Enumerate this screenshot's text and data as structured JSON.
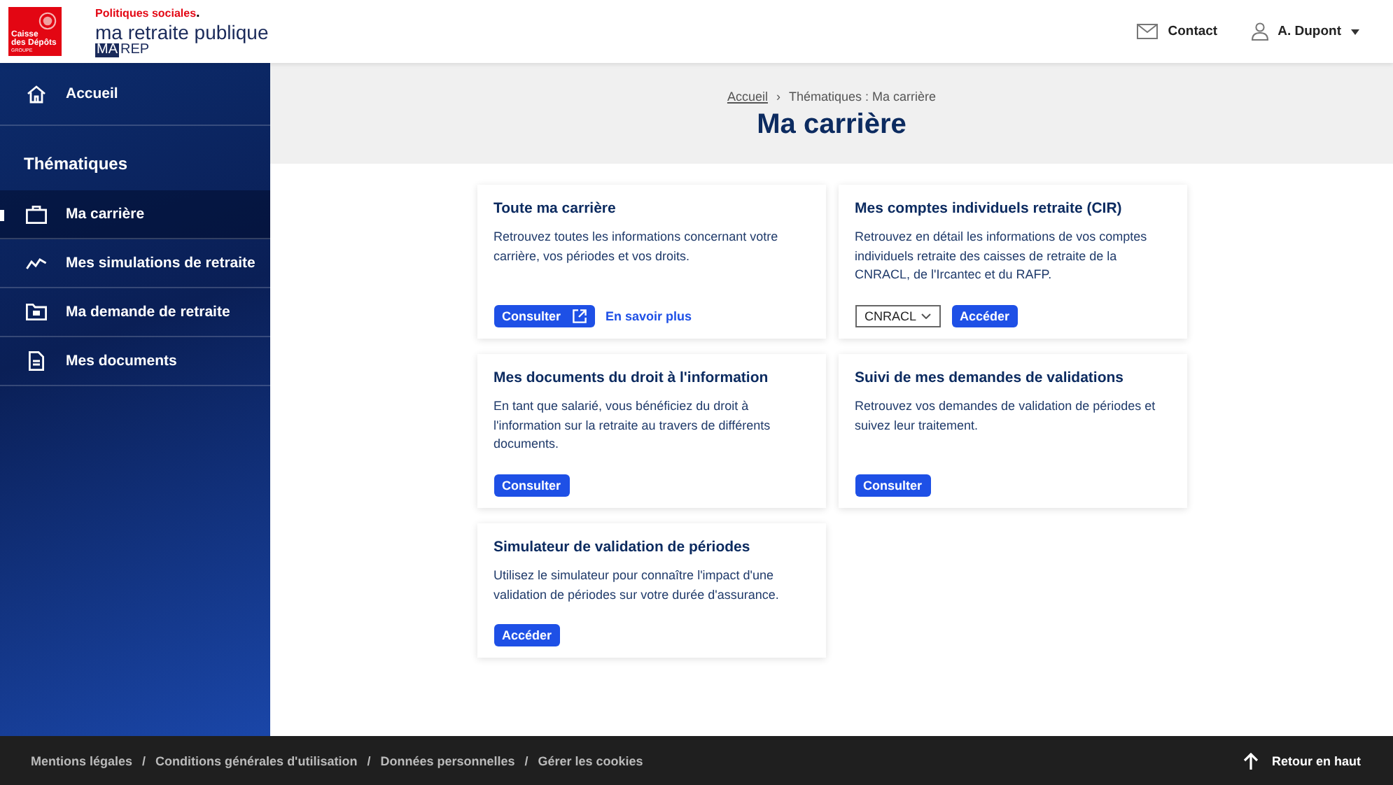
{
  "logo": {
    "lines": [
      "Caisse",
      "des Dépôts"
    ],
    "sub": "GROUPE"
  },
  "brand": {
    "tagline": "Politiques sociales",
    "dot": ".",
    "name": "ma retraite publique",
    "code_a": "MA",
    "code_b": "REP"
  },
  "header_links": [
    {
      "label": "Contact",
      "kind": "mail"
    },
    {
      "label": "A. Dupont",
      "kind": "user"
    }
  ],
  "sidebar": {
    "home": {
      "label": "Accueil",
      "selected": false
    },
    "section": "Thématiques",
    "items": [
      {
        "label": "Ma carrière",
        "selected": true
      },
      {
        "label": "Mes simulations de retraite",
        "selected": false
      },
      {
        "label": "Ma demande de retraite",
        "selected": false
      },
      {
        "label": "Mes documents",
        "selected": false
      }
    ]
  },
  "breadcrumb": {
    "items": [
      "Accueil",
      "Thématiques : Ma carrière"
    ],
    "separator": "›"
  },
  "page_title": "Ma carrière",
  "cards": [
    {
      "title": "Toute ma carrière",
      "text": "Retrouvez toutes les informations concernant votre carrière, vos périodes et vos droits.",
      "actions": [
        {
          "kind": "button",
          "label": "Consulter",
          "external": true
        },
        {
          "kind": "link",
          "label": "En savoir plus"
        }
      ]
    },
    {
      "title": "Mes comptes individuels retraite (CIR)",
      "text": "Retrouvez en détail les informations de vos comptes individuels retraite des caisses de retraite de la CNRACL, de l'Ircantec et du RAFP.",
      "actions": [
        {
          "kind": "select",
          "label": "CNRACL"
        },
        {
          "kind": "button",
          "label": "Accéder",
          "external": false
        }
      ]
    },
    {
      "title": "Mes documents du droit à l'information",
      "text": "En tant que salarié, vous bénéficiez du droit à l'information sur la retraite au travers de différents documents.",
      "actions": [
        {
          "kind": "button",
          "label": "Consulter",
          "external": false
        }
      ]
    },
    {
      "title": "Suivi de mes demandes de validations",
      "text": "Retrouvez vos demandes de validation de périodes et suivez leur traitement.",
      "actions": [
        {
          "kind": "button",
          "label": "Consulter",
          "external": false
        }
      ]
    },
    {
      "title": "Simulateur de validation de périodes",
      "text": "Utilisez le simulateur pour connaître l'impact d'une validation de périodes sur votre durée d'assurance.",
      "actions": [
        {
          "kind": "button",
          "label": "Accéder",
          "external": false
        }
      ]
    }
  ],
  "footer": {
    "links": [
      "Mentions légales",
      "Conditions générales d'utilisation",
      "Données personnelles",
      "Gérer les cookies"
    ],
    "separator": "/",
    "back_to_top": "Retour en haut"
  }
}
